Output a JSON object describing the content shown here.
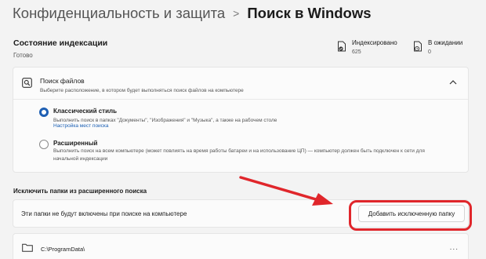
{
  "breadcrumb": {
    "parent": "Конфиденциальность и защита",
    "separator": ">",
    "current": "Поиск в Windows"
  },
  "indexing": {
    "title": "Состояние индексации",
    "state": "Готово",
    "indexed_label": "Индексировано",
    "indexed_count": "625",
    "pending_label": "В ожидании",
    "pending_count": "0"
  },
  "find_files": {
    "title": "Поиск файлов",
    "subtitle": "Выберите расположение, в котором будет выполняться поиск файлов на компьютере",
    "options": [
      {
        "title": "Классический стиль",
        "desc": "Выполнить поиск в папках \"Документы\", \"Изображения\" и \"Музыка\", а также на рабочем столе",
        "link": "Настройка мест поиска",
        "selected": true
      },
      {
        "title": "Расширенный",
        "desc": "Выполнить поиск на всем компьютере (может повлиять на время работы батареи и на использование ЦП) — компьютер должен быть подключен к сети для начальной индексации",
        "selected": false
      }
    ]
  },
  "exclude": {
    "section_label": "Исключить папки из расширенного поиска",
    "description": "Эти папки не будут включены при поиске на компьютере",
    "add_button": "Добавить исключенную папку",
    "folders": [
      {
        "path": "C:\\ProgramData\\",
        "menu": "..."
      }
    ]
  },
  "colors": {
    "accent": "#1e5fb3",
    "annotation_red": "#e0262b"
  }
}
